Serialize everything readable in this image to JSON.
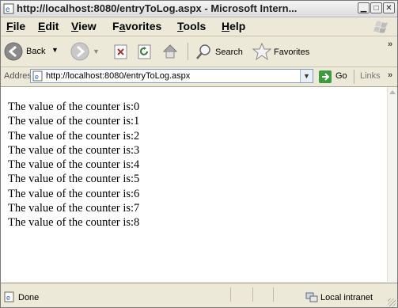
{
  "window": {
    "title": "http://localhost:8080/entryToLog.aspx - Microsoft Intern...",
    "controls": [
      "minimize",
      "maximize",
      "close"
    ]
  },
  "menu": [
    {
      "pre": "",
      "u": "F",
      "post": "ile"
    },
    {
      "pre": "",
      "u": "E",
      "post": "dit"
    },
    {
      "pre": "",
      "u": "V",
      "post": "iew"
    },
    {
      "pre": "F",
      "u": "a",
      "post": "vorites"
    },
    {
      "pre": "",
      "u": "T",
      "post": "ools"
    },
    {
      "pre": "",
      "u": "H",
      "post": "elp"
    }
  ],
  "toolbar": {
    "back_label": "Back",
    "search_label": "Search",
    "favorites_label": "Favorites",
    "overflow": "»"
  },
  "address": {
    "label": "Address",
    "url": "http://localhost:8080/entryToLog.aspx",
    "go_label": "Go",
    "links_label": "Links",
    "overflow": "»"
  },
  "content": {
    "lines": [
      "The value of the counter is:0",
      "The value of the counter is:1",
      "The value of the counter is:2",
      "The value of the counter is:3",
      "The value of the counter is:4",
      "The value of the counter is:5",
      "The value of the counter is:6",
      "The value of the counter is:7",
      "The value of the counter is:8"
    ]
  },
  "status": {
    "text": "Done",
    "zone": "Local intranet"
  }
}
